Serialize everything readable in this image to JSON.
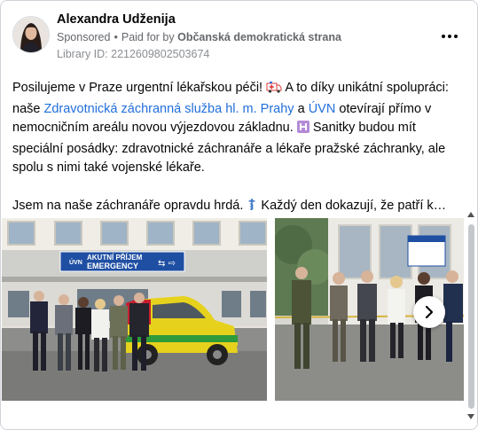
{
  "ad": {
    "advertiser_name": "Alexandra Udženija",
    "sponsored_label": "Sponsored",
    "separator": "•",
    "paid_for_prefix": "Paid for by",
    "paid_for_party": "Občanská demokratická strana",
    "library_id": "Library ID: 2212609802503674",
    "more_icon": "more-options-icon"
  },
  "post": {
    "line1_a": "Posilujeme v Praze urgentní lékařskou péči!",
    "line1_b": "A to díky unikátní spolupráci: naše",
    "link1": "Zdravotnická záchranná služba hl. m. Prahy",
    "link1_after": " a ",
    "link2": "ÚVN",
    "line2_rest": " otevírají přímo v nemocničním areálu novou výjezdovou základnu.",
    "line3": "Sanitky budou mít speciální posádky: zdravotnické záchranáře a lékaře pražské záchranky, ale spolu s nimi také vojenské lékaře.",
    "para2_a": "Jsem na naše záchranáře opravdu hrdá.",
    "para2_b": "Každý den dokazují, že patří k…",
    "emoji_ambulance": "ambulance-emoji",
    "emoji_hospital": "hospital-emoji",
    "emoji_medical": "medical-symbol-emoji"
  },
  "media": {
    "sign_top": "AKUTNÍ PŘÍJEM",
    "sign_bottom": "EMERGENCY",
    "sign_logo": "ÚVN",
    "next_icon": "chevron-right-icon"
  },
  "colors": {
    "link": "#216fdb",
    "sign_blue": "#1f4fa3",
    "ambulance_yellow": "#e6d21c",
    "ambulance_green": "#2e9a3a"
  }
}
